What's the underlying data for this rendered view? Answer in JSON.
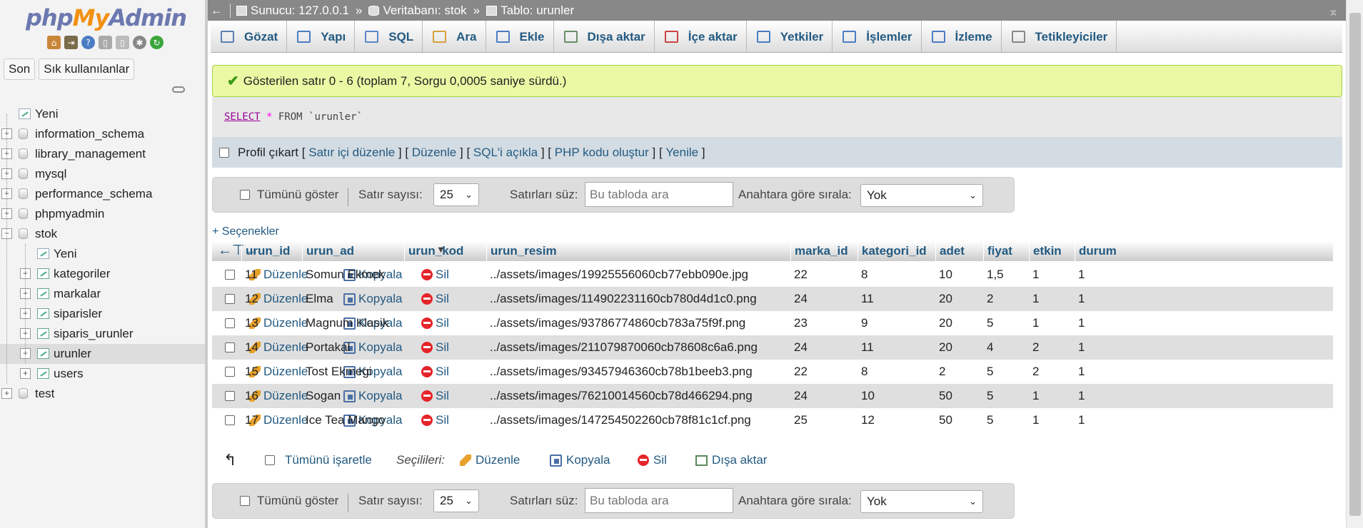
{
  "app": {
    "logo_php": "php",
    "logo_my": "My",
    "logo_admin": "Admin"
  },
  "sidebar": {
    "icons": [
      "home-icon",
      "exit-icon",
      "help-icon",
      "docs-icon",
      "copy-icon",
      "settings-icon",
      "reload-icon"
    ],
    "buttons": {
      "recent": "Son",
      "favorites": "Sık kullanılanlar"
    },
    "tree": [
      {
        "label": "Yeni",
        "type": "new"
      },
      {
        "label": "information_schema",
        "type": "db"
      },
      {
        "label": "library_management",
        "type": "db"
      },
      {
        "label": "mysql",
        "type": "db"
      },
      {
        "label": "performance_schema",
        "type": "db"
      },
      {
        "label": "phpmyadmin",
        "type": "db"
      },
      {
        "label": "stok",
        "type": "db-open"
      },
      {
        "label": "Yeni",
        "type": "child-new"
      },
      {
        "label": "kategoriler",
        "type": "table"
      },
      {
        "label": "markalar",
        "type": "table"
      },
      {
        "label": "siparisler",
        "type": "table"
      },
      {
        "label": "siparis_urunler",
        "type": "table"
      },
      {
        "label": "urunler",
        "type": "table-selected"
      },
      {
        "label": "users",
        "type": "table"
      },
      {
        "label": "test",
        "type": "db"
      }
    ]
  },
  "breadcrumb": {
    "server": "Sunucu: 127.0.0.1",
    "sep1": "»",
    "database": "Veritabanı: stok",
    "sep2": "»",
    "table": "Tablo: urunler"
  },
  "tabs": [
    "Gözat",
    "Yapı",
    "SQL",
    "Ara",
    "Ekle",
    "Dışa aktar",
    "İçe aktar",
    "Yetkiler",
    "İşlemler",
    "İzleme",
    "Tetikleyiciler"
  ],
  "message": "Gösterilen satır 0 - 6 (toplam 7, Sorgu 0,0005 saniye sürdü.)",
  "sql": {
    "select": "SELECT",
    "star": "*",
    "rest": "FROM `urunler`"
  },
  "sql_ops": {
    "profile": "Profil çıkart",
    "open": "[",
    "close": "]",
    "inline": "Satır içi düzenle",
    "edit": "Düzenle",
    "explain": "SQL'i açıkla",
    "php": "PHP kodu oluştur",
    "refresh": "Yenile"
  },
  "nav": {
    "show_all": "Tümünü göster",
    "rows_label": "Satır sayısı:",
    "rows_value": "25",
    "filter_label": "Satırları süz:",
    "filter_placeholder": "Bu tabloda ara",
    "sort_label": "Anahtara göre sırala:",
    "sort_value": "Yok"
  },
  "options_link": "+ Seçenekler",
  "columns": [
    "urun_id",
    "urun_ad",
    "urun_kod",
    "urun_resim",
    "marka_id",
    "kategori_id",
    "adet",
    "fiyat",
    "etkin",
    "durum"
  ],
  "row_actions": {
    "edit": "Düzenle",
    "copy": "Kopyala",
    "delete": "Sil"
  },
  "rows": [
    [
      "11",
      "Somun Ekmek",
      "",
      "../assets/images/19925556060cb77ebb090e.jpg",
      "22",
      "8",
      "10",
      "1,5",
      "1",
      "1"
    ],
    [
      "12",
      "Elma",
      "",
      "../assets/images/114902231160cb780d4d1c0.png",
      "24",
      "11",
      "20",
      "2",
      "1",
      "1"
    ],
    [
      "13",
      "Magnum Klasik",
      "",
      "../assets/images/93786774860cb783a75f9f.png",
      "23",
      "9",
      "20",
      "5",
      "1",
      "1"
    ],
    [
      "14",
      "Portakal",
      "",
      "../assets/images/211079870060cb78608c6a6.png",
      "24",
      "11",
      "20",
      "4",
      "2",
      "1"
    ],
    [
      "15",
      "Tost Ekmegi",
      "",
      "../assets/images/93457946360cb78b1beeb3.png",
      "22",
      "8",
      "2",
      "5",
      "2",
      "1"
    ],
    [
      "16",
      "Sogan",
      "",
      "../assets/images/76210014560cb78d466294.png",
      "24",
      "10",
      "50",
      "5",
      "1",
      "1"
    ],
    [
      "17",
      "Ice Tea Mango",
      "",
      "../assets/images/147254502260cb78f81c1cf.png",
      "25",
      "12",
      "50",
      "5",
      "1",
      "1"
    ]
  ],
  "bulk": {
    "check_all": "Tümünü işaretle",
    "with_selected": "Seçilileri:",
    "edit": "Düzenle",
    "copy": "Kopyala",
    "delete": "Sil",
    "export": "Dışa aktar"
  }
}
